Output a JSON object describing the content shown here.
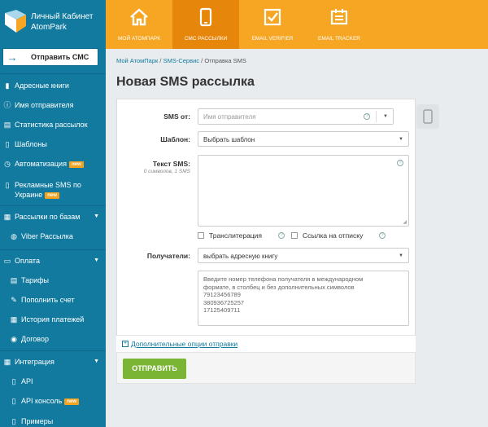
{
  "sidebar": {
    "logo_line1": "Личный Кабинет",
    "logo_line2": "AtomPark",
    "send_sms": "Отправить СМС",
    "new_badge": "new",
    "items": [
      {
        "label": "Адресные книги",
        "icon": "book-icon"
      },
      {
        "label": "Имя отправителя",
        "icon": "info-icon"
      },
      {
        "label": "Статистика рассылок",
        "icon": "chart-icon"
      },
      {
        "label": "Шаблоны",
        "icon": "file-icon"
      },
      {
        "label": "Автоматизация",
        "icon": "clock-icon"
      },
      {
        "label": "Рекламные SMS по",
        "label2": "Украине",
        "icon": "mobile-icon"
      },
      {
        "label": "Рассылки по базам",
        "icon": "layers-icon"
      },
      {
        "label": "Viber Рассылка",
        "icon": "viber-icon"
      },
      {
        "label": "Оплата",
        "icon": "card-icon"
      },
      {
        "label": "Тарифы",
        "icon": "list-icon"
      },
      {
        "label": "Пополнить счет",
        "icon": "edit-icon"
      },
      {
        "label": "История платежей",
        "icon": "history-icon"
      },
      {
        "label": "Договор",
        "icon": "globe-icon"
      },
      {
        "label": "Интеграция",
        "icon": "plug-icon"
      },
      {
        "label": "API",
        "icon": "doc-icon"
      },
      {
        "label": "API консоль",
        "icon": "doc-icon"
      },
      {
        "label": "Примеры",
        "icon": "doc-icon"
      }
    ]
  },
  "topnav": {
    "tabs": [
      {
        "label": "Мой АтомПарк",
        "icon": "home-icon"
      },
      {
        "label": "СМС Рассылки",
        "icon": "mobile-icon"
      },
      {
        "label": "Email Verifier",
        "icon": "checkbox-icon"
      },
      {
        "label": "Email Tracker",
        "icon": "tracker-icon"
      }
    ]
  },
  "breadcrumb": {
    "items": [
      "Мой АтомПарк",
      "SMS-Сервис",
      "Отправка SMS"
    ],
    "sep": "/"
  },
  "page": {
    "title": "Новая SMS рассылка"
  },
  "form": {
    "sms_from_label": "SMS от:",
    "sms_from_placeholder": "Имя отправителя",
    "template_label": "Шаблон:",
    "template_value": "Выбрать шаблон",
    "text_label": "Текст SMS:",
    "text_counter": "0 символов, 1 SMS",
    "translit_label": "Транслитерация",
    "unsubscribe_label": "Ссылка на отписку",
    "recipients_label": "Получатели:",
    "recipients_value": "выбрать адресную книгу",
    "phones_hint_lines": [
      "Введите номер телефона получателя в международном",
      "формате, в столбец и без дополнительных символов",
      "79123456789",
      "380936725257",
      "17125409711"
    ],
    "more_options": "Дополнительные опции отправки",
    "submit": "ОТПРАВИТЬ"
  },
  "colors": {
    "sidebar": "#117a9e",
    "topbar": "#f6a623",
    "topbar_active": "#e6860a",
    "submit": "#7ab534"
  }
}
